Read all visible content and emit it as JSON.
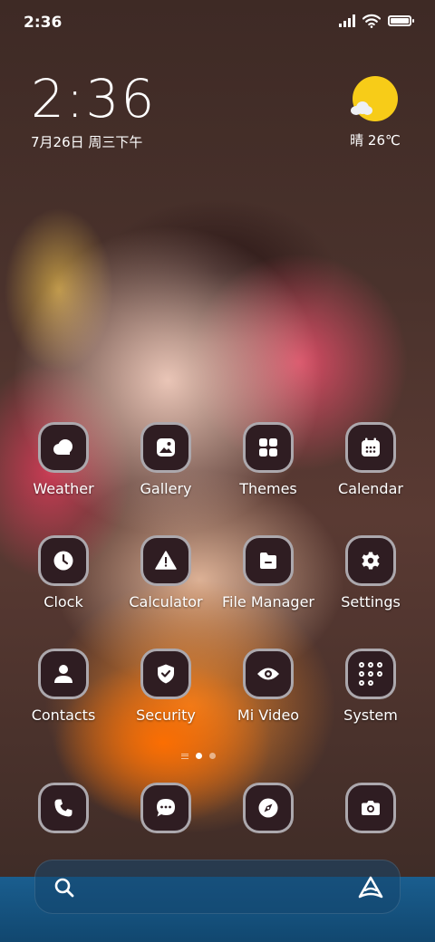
{
  "status_bar": {
    "time": "2:36"
  },
  "lockclock": {
    "time": "2:36",
    "date": "7月26日 周三下午"
  },
  "weather_widget": {
    "text": "晴 26℃"
  },
  "apps": [
    {
      "label": "Weather"
    },
    {
      "label": "Gallery"
    },
    {
      "label": "Themes"
    },
    {
      "label": "Calendar"
    },
    {
      "label": "Clock"
    },
    {
      "label": "Calculator"
    },
    {
      "label": "File Manager"
    },
    {
      "label": "Settings"
    },
    {
      "label": "Contacts"
    },
    {
      "label": "Security"
    },
    {
      "label": "Mi Video"
    },
    {
      "label": "System"
    }
  ],
  "dock": [
    "phone-icon",
    "messages-icon",
    "browser-compass-icon",
    "camera-icon"
  ],
  "colors": {
    "sun": "#f7cc18",
    "icon_bg": "#2f1d22",
    "bottom": "#1a5e8f"
  }
}
